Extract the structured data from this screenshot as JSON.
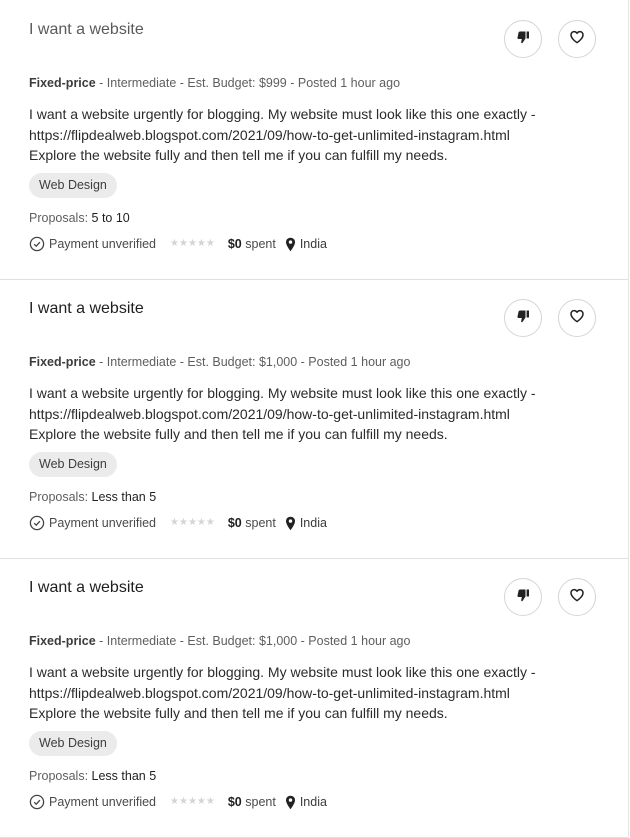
{
  "jobs": [
    {
      "title": "I want a website",
      "meta": {
        "type": "Fixed-price",
        "rest": " - Intermediate - Est. Budget: $999 - Posted 1 hour ago"
      },
      "description": [
        "I want a website urgently for blogging. My website must look like this one exactly -",
        "https://flipdealweb.blogspot.com/2021/09/how-to-get-unlimited-instagram.html",
        "Explore the website fully and then tell me if you can fulfill my needs."
      ],
      "tag": "Web Design",
      "proposals": {
        "label": "Proposals: ",
        "value": "5 to 10"
      },
      "client": {
        "payment": "Payment unverified",
        "spent_amount": "$0",
        "spent_label": " spent",
        "location": "India"
      }
    },
    {
      "title": "I want a website",
      "meta": {
        "type": "Fixed-price",
        "rest": " - Intermediate - Est. Budget: $1,000 - Posted 1 hour ago"
      },
      "description": [
        "I want a website urgently for blogging. My website must look like this one exactly -",
        "https://flipdealweb.blogspot.com/2021/09/how-to-get-unlimited-instagram.html",
        "Explore the website fully and then tell me if you can fulfill my needs."
      ],
      "tag": "Web Design",
      "proposals": {
        "label": "Proposals: ",
        "value": "Less than 5"
      },
      "client": {
        "payment": "Payment unverified",
        "spent_amount": "$0",
        "spent_label": " spent",
        "location": "India"
      }
    },
    {
      "title": "I want a website",
      "meta": {
        "type": "Fixed-price",
        "rest": " - Intermediate - Est. Budget: $1,000 - Posted 1 hour ago"
      },
      "description": [
        "I want a website urgently for blogging. My website must look like this one exactly -",
        "https://flipdealweb.blogspot.com/2021/09/how-to-get-unlimited-instagram.html",
        "Explore the website fully and then tell me if you can fulfill my needs."
      ],
      "tag": "Web Design",
      "proposals": {
        "label": "Proposals: ",
        "value": "Less than 5"
      },
      "client": {
        "payment": "Payment unverified",
        "spent_amount": "$0",
        "spent_label": " spent",
        "location": "India"
      }
    }
  ],
  "icons": {
    "dislike": "thumbs-down-icon",
    "save": "heart-icon",
    "payment": "check-circle-icon",
    "rating": "star-rating-icon",
    "location": "map-pin-icon"
  },
  "colors": {
    "text": "#222222",
    "muted": "#5e5e5e",
    "tag_bg": "#ebebeb",
    "divider": "#e0e0e0"
  }
}
